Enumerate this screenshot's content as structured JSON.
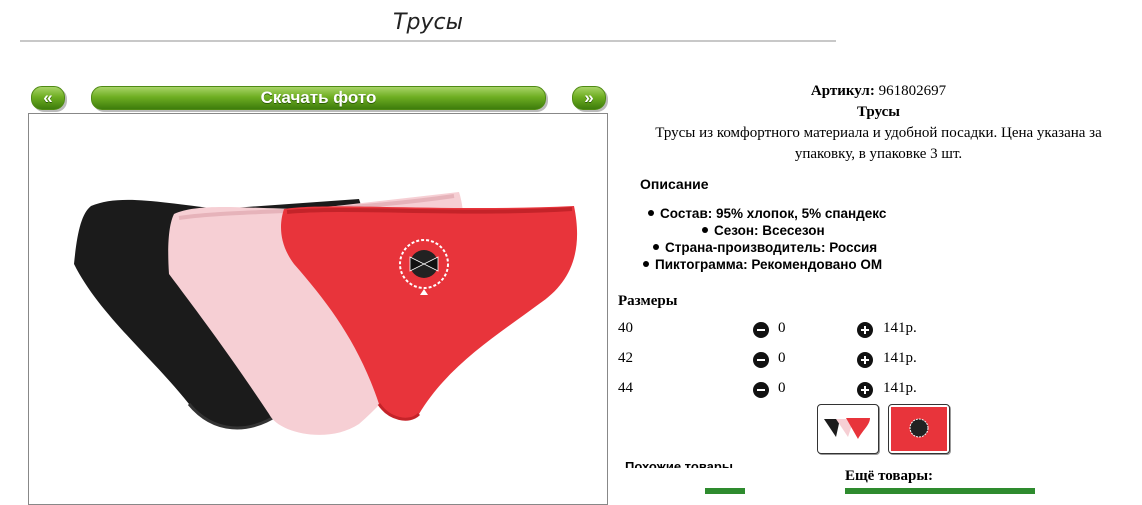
{
  "page": {
    "title": "Трусы"
  },
  "gallery": {
    "prev_label": "«",
    "download_label": "Скачать фото",
    "next_label": "»"
  },
  "product": {
    "article_label": "Артикул:",
    "article_value": "961802697",
    "name": "Трусы",
    "description_line1": "Трусы из комфортного материала и удобной посадки. Цена указана за",
    "description_line2": "упаковку, в упаковке 3 шт.",
    "description_heading": "Описание",
    "properties": [
      "Состав: 95% хлопок, 5% спандекс",
      "Сезон: Всесезон",
      "Страна-производитель: Россия",
      "Пиктограмма: Рекомендовано ОМ"
    ]
  },
  "sizes": {
    "heading": "Размеры",
    "rows": [
      {
        "size": "40",
        "qty": "0",
        "price": "141р."
      },
      {
        "size": "42",
        "qty": "0",
        "price": "141р."
      },
      {
        "size": "44",
        "qty": "0",
        "price": "141р."
      }
    ]
  },
  "footer": {
    "left_cut_text": "Похожие товары",
    "more_label": "Ещё товары:"
  },
  "colors": {
    "accent_green": "#6fae22",
    "panties_red": "#e8343b",
    "panties_pink": "#f6cdd3",
    "panties_black": "#1a1a1a"
  }
}
